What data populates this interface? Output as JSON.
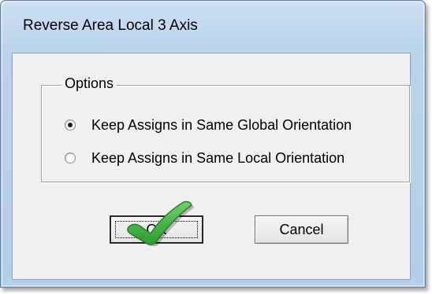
{
  "window": {
    "title": "Reverse Area Local 3 Axis"
  },
  "options": {
    "legend": "Options",
    "items": [
      {
        "label": "Keep Assigns in Same Global Orientation",
        "checked": true
      },
      {
        "label": "Keep Assigns in Same Local Orientation",
        "checked": false
      }
    ]
  },
  "buttons": {
    "ok_label": "OK",
    "cancel_label": "Cancel"
  },
  "overlay": {
    "icon": "green-checkmark-icon",
    "color": "#3aa83a"
  }
}
